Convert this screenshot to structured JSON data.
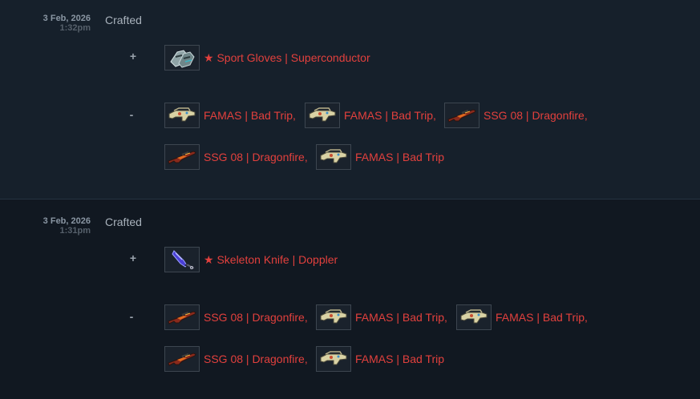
{
  "entries": [
    {
      "date": "3 Feb, 2026",
      "time": "1:32pm",
      "action": "Crafted",
      "received_sign": "+",
      "lost_sign": "-",
      "received": [
        {
          "name": "★ Sport Gloves | Superconductor",
          "icon": "sport-gloves-icon"
        }
      ],
      "lost": [
        {
          "name": "FAMAS | Bad Trip",
          "sep": ",",
          "icon": "famas-icon"
        },
        {
          "name": "FAMAS | Bad Trip",
          "sep": ",",
          "icon": "famas-icon"
        },
        {
          "name": "SSG 08 | Dragonfire",
          "sep": ",",
          "icon": "ssg08-icon"
        },
        {
          "name": "SSG 08 | Dragonfire",
          "sep": ",",
          "icon": "ssg08-icon"
        },
        {
          "name": "FAMAS | Bad Trip",
          "sep": "",
          "icon": "famas-icon"
        }
      ]
    },
    {
      "date": "3 Feb, 2026",
      "time": "1:31pm",
      "action": "Crafted",
      "received_sign": "+",
      "lost_sign": "-",
      "received": [
        {
          "name": "★ Skeleton Knife | Doppler",
          "icon": "skeleton-knife-icon"
        }
      ],
      "lost": [
        {
          "name": "SSG 08 | Dragonfire",
          "sep": ",",
          "icon": "ssg08-icon"
        },
        {
          "name": "FAMAS | Bad Trip",
          "sep": ",",
          "icon": "famas-icon"
        },
        {
          "name": "FAMAS | Bad Trip",
          "sep": ",",
          "icon": "famas-icon"
        },
        {
          "name": "SSG 08 | Dragonfire",
          "sep": ",",
          "icon": "ssg08-icon"
        },
        {
          "name": "FAMAS | Bad Trip",
          "sep": "",
          "icon": "famas-icon"
        }
      ]
    }
  ],
  "colors": {
    "item_name": "#e2403d",
    "action_text": "#a9b2bc",
    "date_text": "#8a96a3",
    "time_text": "#56606b"
  }
}
